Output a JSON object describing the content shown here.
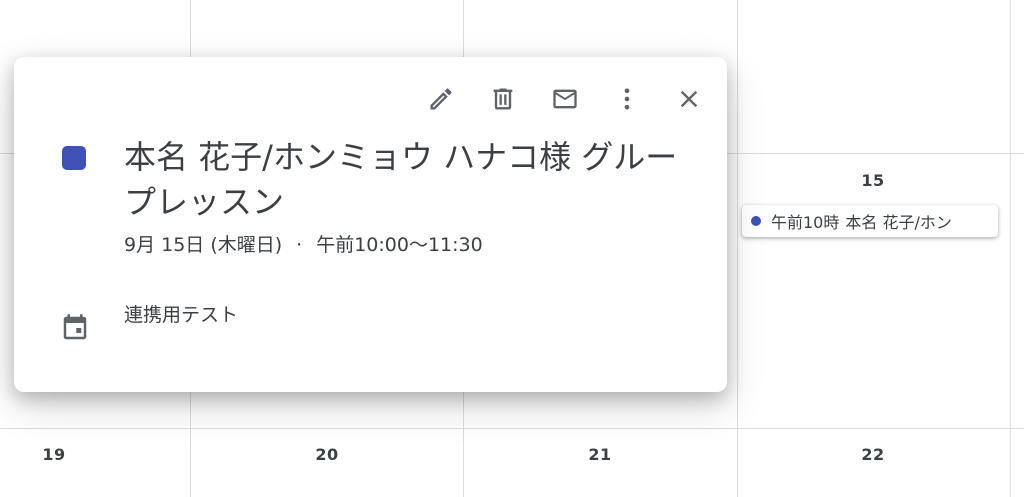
{
  "calendar": {
    "day_numbers": [
      "15",
      "19",
      "20",
      "21",
      "22"
    ],
    "event_chip": {
      "color": "#3f51b5",
      "time": "午前10時",
      "title": "本名 花子/ホン"
    }
  },
  "popup": {
    "toolbar": {
      "edit_icon": "pencil-icon",
      "delete_icon": "trash-icon",
      "email_icon": "mail-icon",
      "more_icon": "more-vert-icon",
      "close_icon": "close-icon"
    },
    "event_color": "#3f51b5",
    "title": "本名 花子/ホンミョウ ハナコ様 グループレッスン",
    "date": "9月 15日 (木曜日)",
    "separator": "·",
    "time": "午前10:00〜11:30",
    "calendar_name": "連携用テスト",
    "calendar_icon": "calendar-icon"
  }
}
